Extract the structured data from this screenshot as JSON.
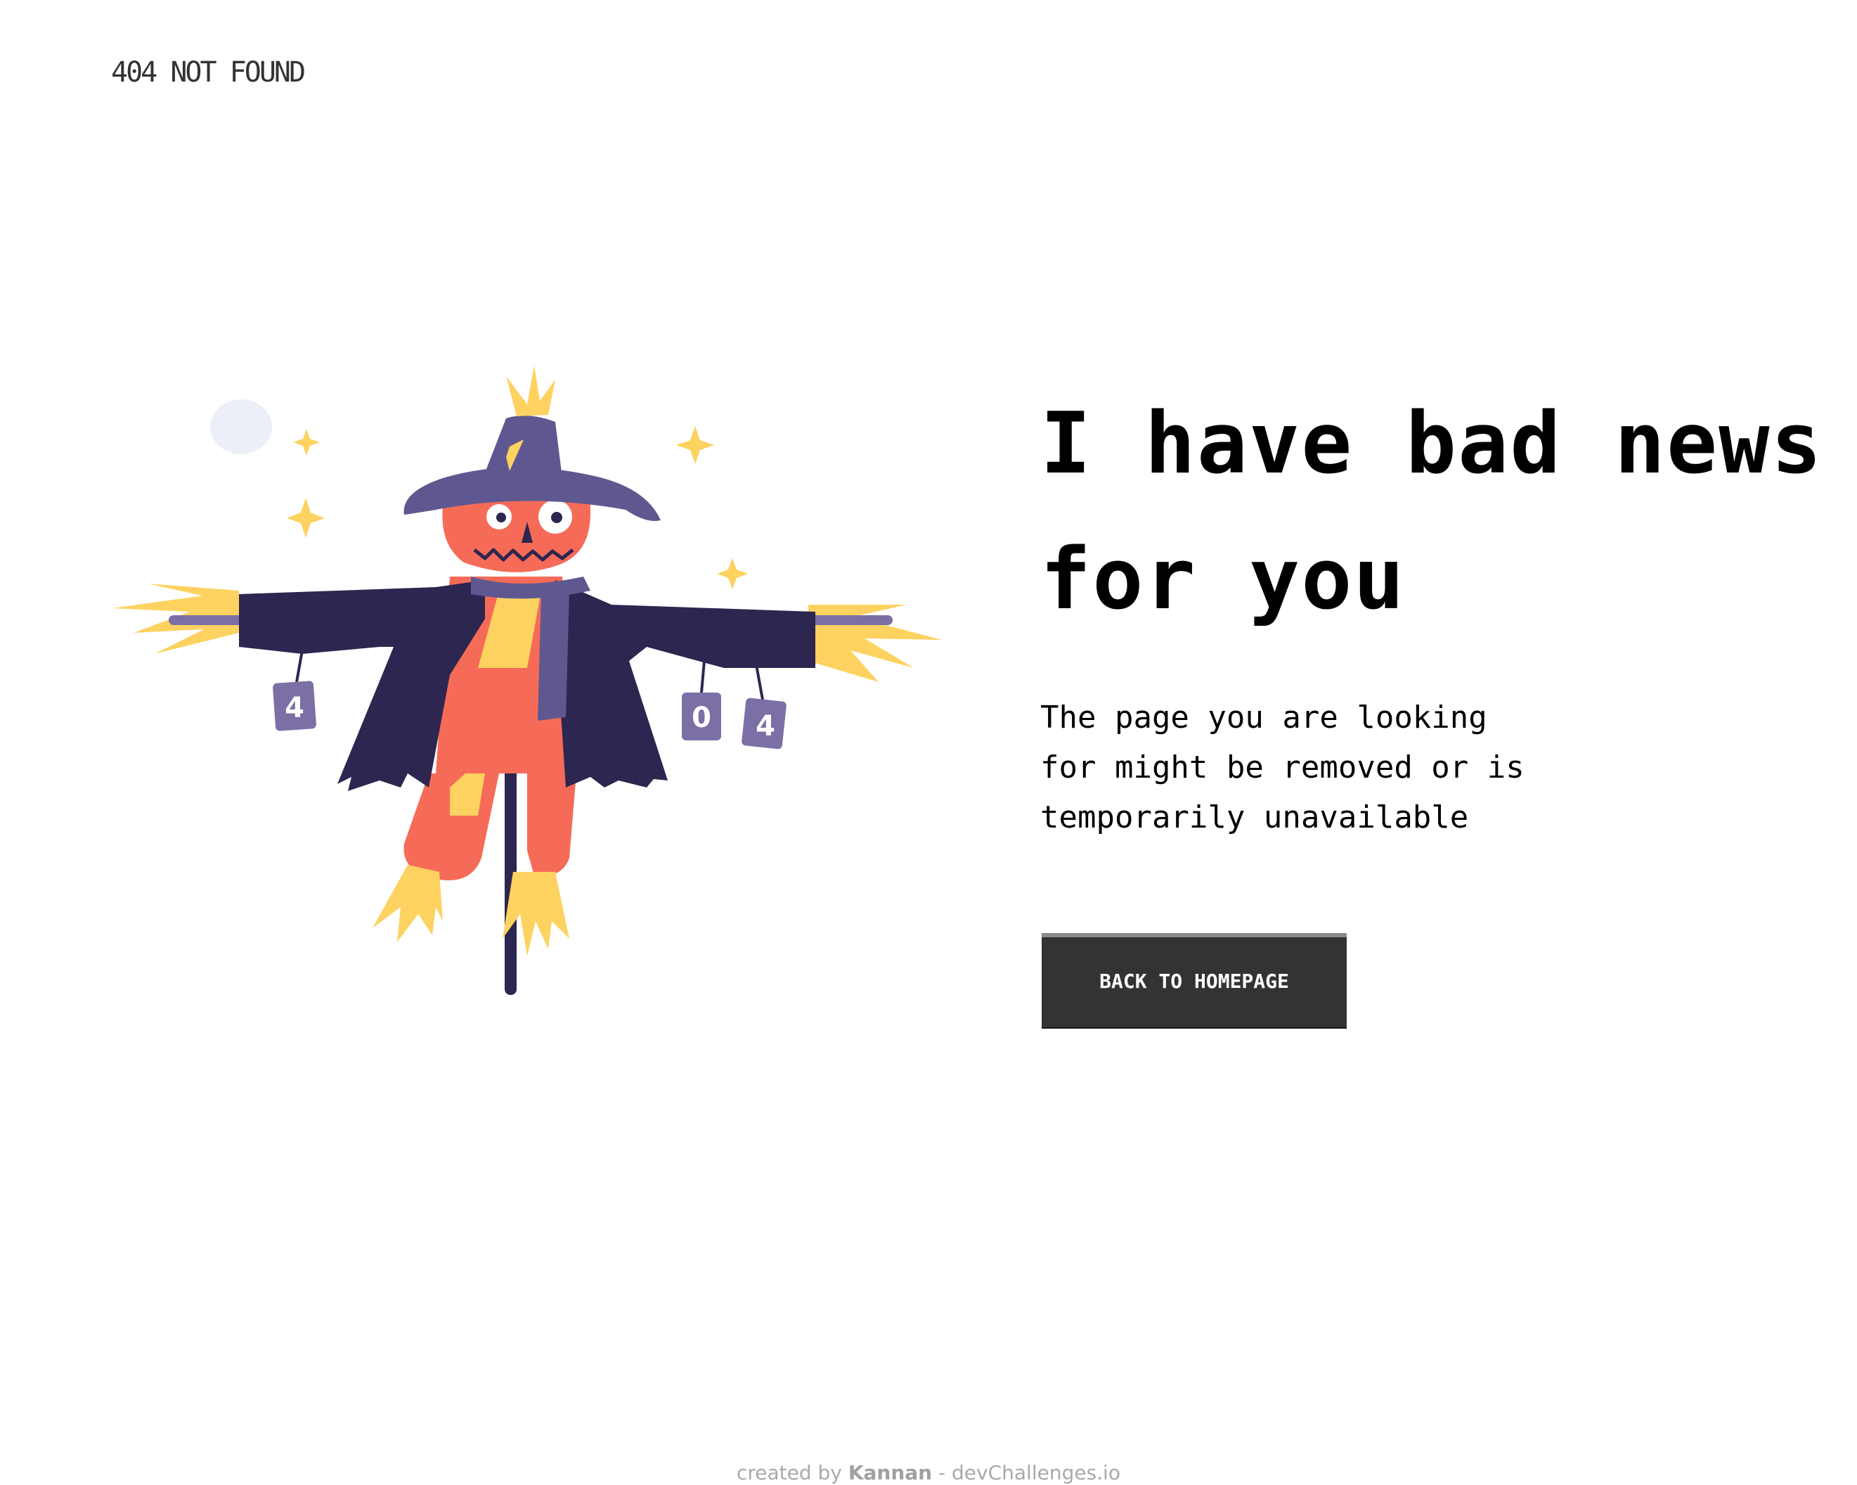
{
  "header": {
    "brand": "404 NOT FOUND"
  },
  "illustration": {
    "subject": "scarecrow",
    "cans": [
      "4",
      "0",
      "4"
    ]
  },
  "main": {
    "headline_line1": "I have bad news",
    "headline_line2": "for you",
    "message_line1": "The page you are looking",
    "message_line2": "for might be removed or is",
    "message_line3": "temporarily unavailable",
    "button_label": "BACK TO HOMEPAGE"
  },
  "footer": {
    "prefix": "created by ",
    "author": "Kannan",
    "separator": " - ",
    "site": "devChallenges.io"
  },
  "colors": {
    "dark": "#2d2650",
    "purple": "#5f5890",
    "purple_light": "#7b6fa6",
    "orange": "#f66b57",
    "yellow": "#fdd260",
    "button_bg": "#333333",
    "moon": "#eceff7"
  }
}
